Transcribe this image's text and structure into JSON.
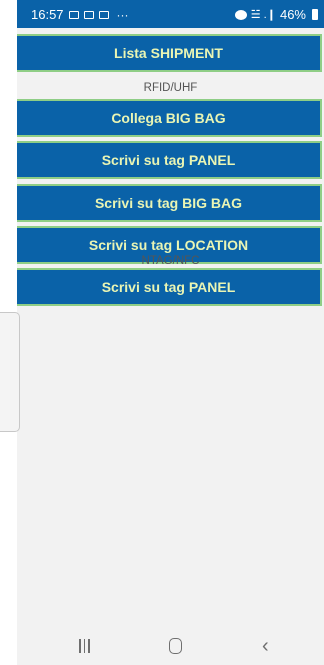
{
  "status_bar": {
    "time": "16:57",
    "overflow": "···",
    "battery": "46%",
    "signal": "☱ .❙"
  },
  "buttons": {
    "lista_shipment": "Lista SHIPMENT",
    "collega_big_bag": "Collega BIG BAG",
    "scrivi_panel": "Scrivi su tag PANEL",
    "scrivi_big_bag": "Scrivi su tag BIG BAG",
    "scrivi_location": "Scrivi su tag LOCATION",
    "scrivi_panel_nfc": "Scrivi su tag PANEL"
  },
  "sections": {
    "rfid": "RFID/UHF",
    "nfc": "NTAG/NFC"
  },
  "navbar": {
    "back_glyph": "‹"
  }
}
